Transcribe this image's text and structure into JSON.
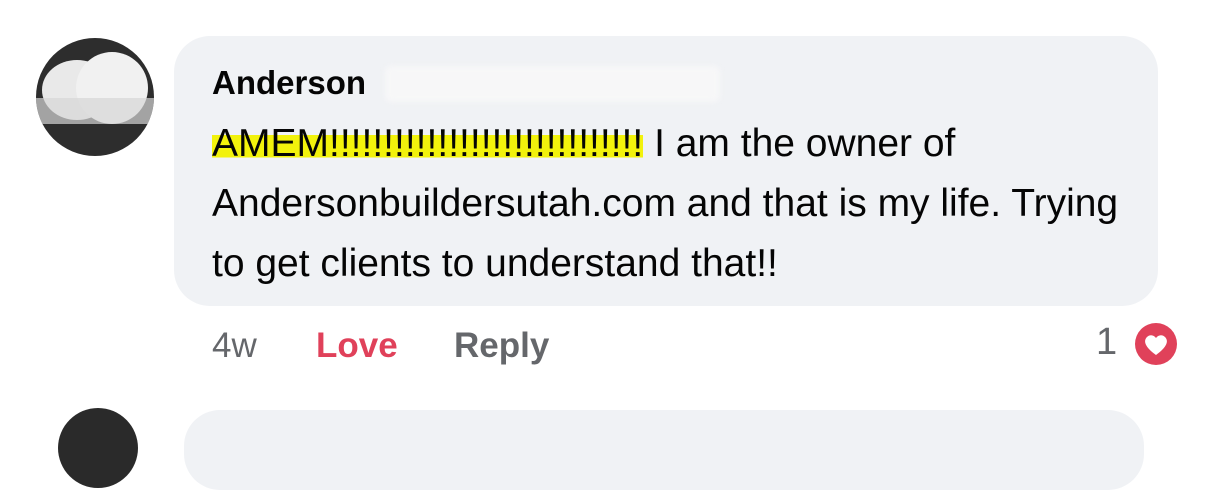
{
  "comment": {
    "author": "Anderson",
    "text_highlighted": "AMEM!!!!!!!!!!!!!!!!!!!!!!!!!!!!!",
    "text_rest": " I am the owner of Andersonbuildersutah.com and that is my life. Trying to get clients to understand that!!",
    "timestamp": "4w",
    "love_label": "Love",
    "reply_label": "Reply",
    "reaction_count": "1",
    "reaction_icon": "heart-icon",
    "colors": {
      "bubble": "#f0f2f5",
      "love": "#e0415a",
      "highlight": "#f2f20c",
      "secondary_text": "#65676b"
    }
  }
}
